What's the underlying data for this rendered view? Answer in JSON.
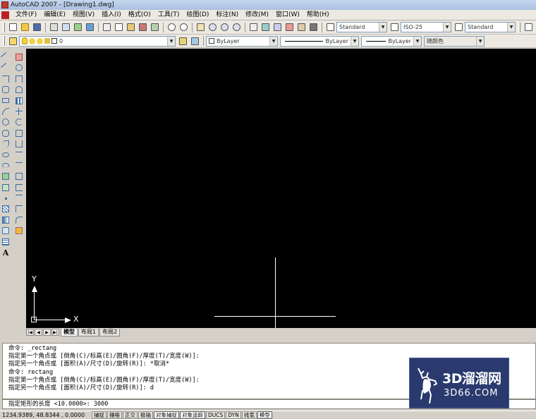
{
  "window": {
    "title": "AutoCAD 2007 - [Drawing1.dwg]"
  },
  "menu": {
    "items": [
      "文件(F)",
      "编辑(E)",
      "视图(V)",
      "插入(I)",
      "格式(O)",
      "工具(T)",
      "绘图(D)",
      "标注(N)",
      "修改(M)",
      "窗口(W)",
      "帮助(H)"
    ]
  },
  "standard_toolbar": {
    "text_style": "Standard",
    "dim_style": "ISO-25",
    "table_style": "Standard"
  },
  "properties_toolbar": {
    "layer": "0",
    "color": "ByLayer",
    "linetype": "ByLayer",
    "lineweight": "ByLayer",
    "plot_style": "随颜色"
  },
  "canvas": {
    "ucs_y_label": "Y",
    "ucs_x_label": "X"
  },
  "tabs": {
    "items": [
      "模型",
      "布局1",
      "布局2"
    ],
    "active": "模型"
  },
  "command": {
    "history": [
      "命令: _rectang",
      "指定第一个角点或 [倒角(C)/标高(E)/圆角(F)/厚度(T)/宽度(W)]:",
      "指定另一个角点或 [面积(A)/尺寸(D)/旋转(R)]: *取消*",
      "命令: rectang",
      "指定第一个角点或 [倒角(C)/标高(E)/圆角(F)/厚度(T)/宽度(W)]:",
      "指定另一个角点或 [面积(A)/尺寸(D)/旋转(R)]: d"
    ],
    "prompt": "指定矩形的长度 <10.0000>: 3000"
  },
  "status": {
    "coords": "1234.9389, 48.8344 , 0.0000",
    "buttons": [
      "捕捉",
      "栅格",
      "正交",
      "极轴",
      "对象捕捉",
      "对象追踪",
      "DUCS",
      "DYN",
      "线宽",
      "模型"
    ],
    "on_flags": [
      false,
      false,
      false,
      false,
      true,
      true,
      false,
      false,
      false,
      true
    ]
  },
  "watermark": {
    "title": "3D溜溜网",
    "subtitle": "3D66.COM"
  }
}
